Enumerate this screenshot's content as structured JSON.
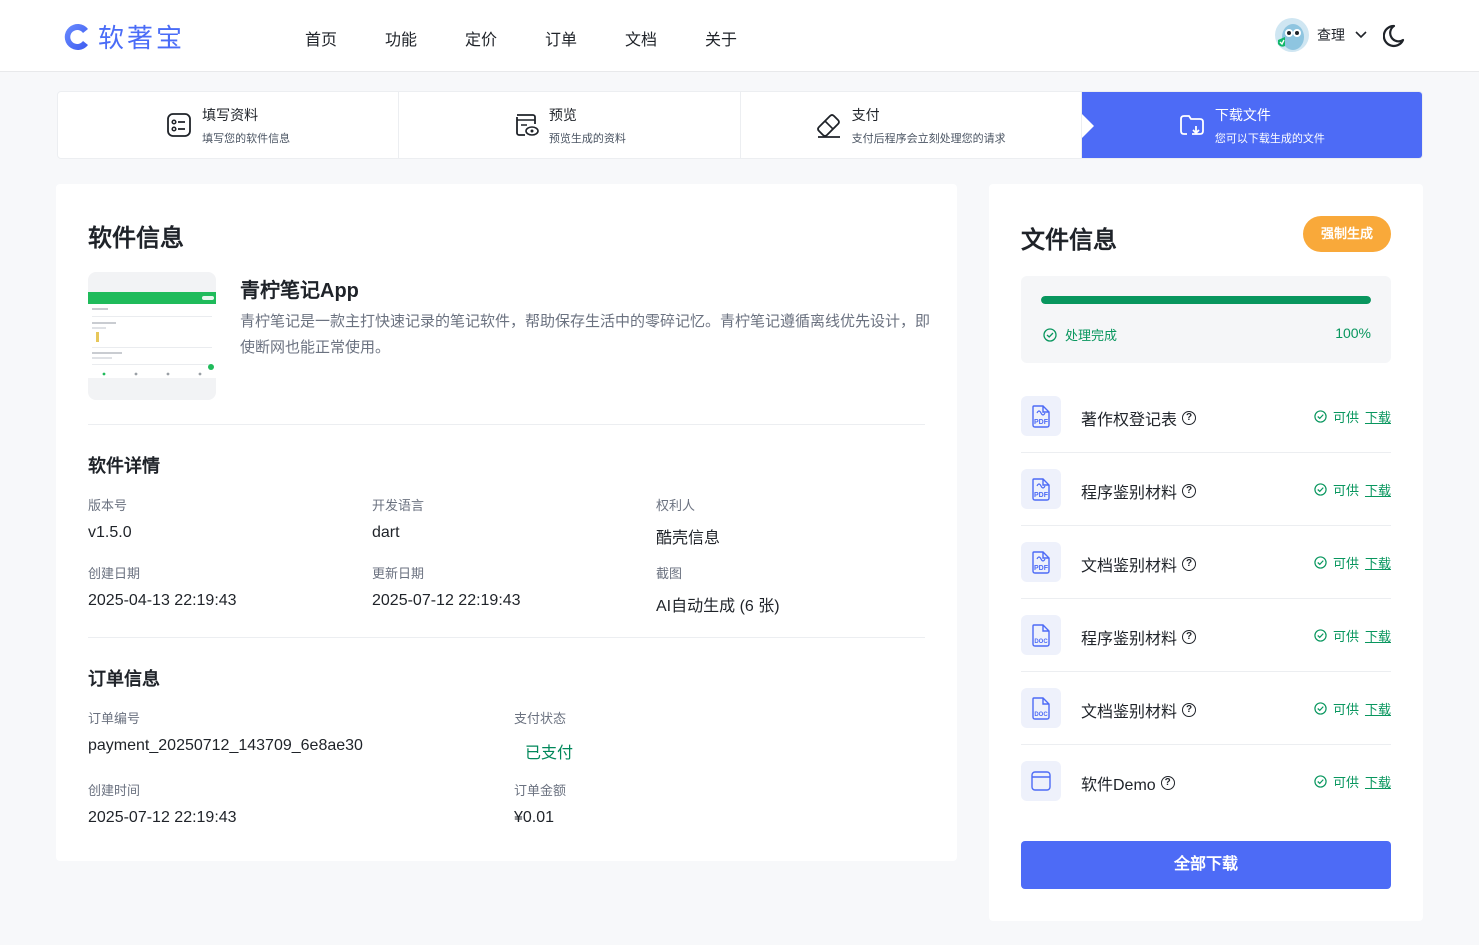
{
  "header": {
    "logo_text": "软著宝",
    "nav": [
      "首页",
      "功能",
      "定价",
      "订单",
      "文档",
      "关于"
    ],
    "user_name": "查理"
  },
  "steps": [
    {
      "title": "填写资料",
      "sub": "填写您的软件信息",
      "icon": "form-icon"
    },
    {
      "title": "预览",
      "sub": "预览生成的资料",
      "icon": "preview-icon"
    },
    {
      "title": "支付",
      "sub": "支付后程序会立刻处理您的请求",
      "icon": "pay-icon"
    },
    {
      "title": "下载文件",
      "sub": "您可以下载生成的文件",
      "icon": "folder-download-icon"
    }
  ],
  "software": {
    "title": "软件信息",
    "app_name": "青柠笔记App",
    "description": "青柠笔记是一款主打快速记录的笔记软件，帮助保存生活中的零碎记忆。青柠笔记遵循离线优先设计，即使断网也能正常使用。",
    "details_title": "软件详情",
    "fields": [
      {
        "label": "版本号",
        "value": "v1.5.0"
      },
      {
        "label": "开发语言",
        "value": "dart"
      },
      {
        "label": "权利人",
        "value": "酷壳信息"
      },
      {
        "label": "创建日期",
        "value": "2025-04-13 22:19:43"
      },
      {
        "label": "更新日期",
        "value": "2025-07-12 22:19:43"
      },
      {
        "label": "截图",
        "value": "AI自动生成 (6 张)"
      }
    ]
  },
  "order": {
    "title": "订单信息",
    "fields": [
      {
        "label": "订单编号",
        "value": "payment_20250712_143709_6e8ae30"
      },
      {
        "label": "支付状态",
        "value": "已支付"
      },
      {
        "label": "创建时间",
        "value": "2025-07-12 22:19:43"
      },
      {
        "label": "订单金额",
        "value": "¥0.01"
      }
    ]
  },
  "files": {
    "title": "文件信息",
    "force_label": "强制生成",
    "progress": {
      "status": "处理完成",
      "percent_text": "100%",
      "value": 1.0
    },
    "items": [
      {
        "name": "著作权登记表",
        "type": "PDF",
        "status": "可供",
        "action": "下载"
      },
      {
        "name": "程序鉴别材料",
        "type": "PDF",
        "status": "可供",
        "action": "下载"
      },
      {
        "name": "文档鉴别材料",
        "type": "PDF",
        "status": "可供",
        "action": "下载"
      },
      {
        "name": "程序鉴别材料",
        "type": "DOC",
        "status": "可供",
        "action": "下载"
      },
      {
        "name": "文档鉴别材料",
        "type": "DOC",
        "status": "可供",
        "action": "下载"
      },
      {
        "name": "软件Demo",
        "type": "APP",
        "status": "可供",
        "action": "下载"
      }
    ],
    "download_all": "全部下载"
  },
  "colors": {
    "accent": "#4d6bf6",
    "success": "#08965e",
    "warning": "#f9a93a"
  }
}
